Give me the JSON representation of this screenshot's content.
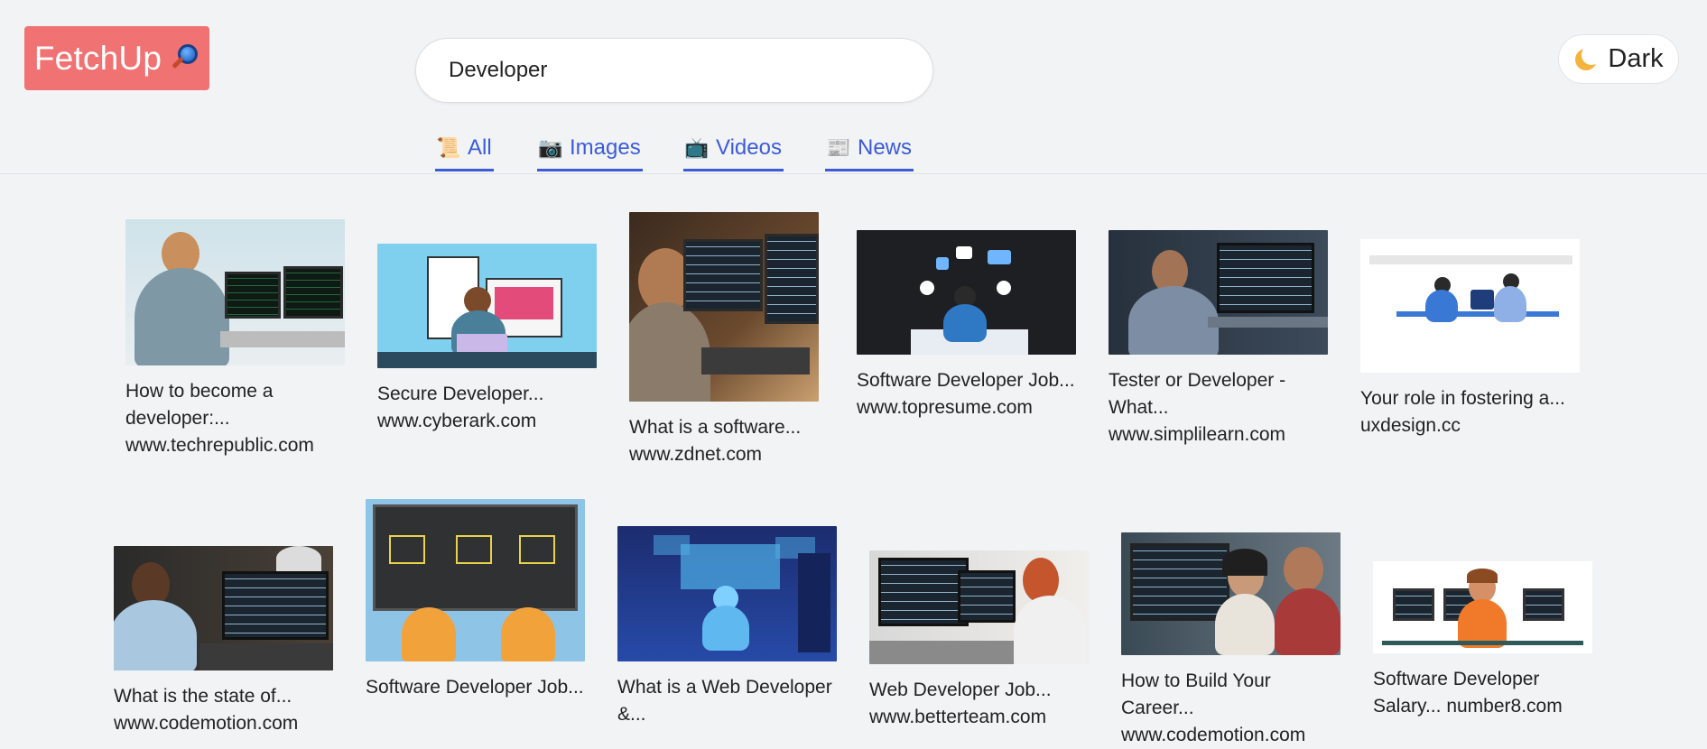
{
  "brand": {
    "name": "FetchUp",
    "icon": "magnifier-icon"
  },
  "search": {
    "value": "Developer"
  },
  "theme_toggle": {
    "label": "Dark",
    "icon": "moon-icon"
  },
  "tabs": [
    {
      "label": "All",
      "icon": "scroll-icon",
      "glyph": "📜"
    },
    {
      "label": "Images",
      "icon": "camera-icon",
      "glyph": "📷"
    },
    {
      "label": "Videos",
      "icon": "tv-icon",
      "glyph": "📺"
    },
    {
      "label": "News",
      "icon": "newspaper-icon",
      "glyph": "📰"
    }
  ],
  "results": [
    {
      "title": "How to become a developer:...",
      "source": "www.techrepublic.com"
    },
    {
      "title": "Secure Developer...",
      "source": "www.cyberark.com"
    },
    {
      "title": "What is a software...",
      "source": "www.zdnet.com"
    },
    {
      "title": "Software Developer Job...",
      "source": "www.topresume.com"
    },
    {
      "title": "Tester or Developer - What...",
      "source": "www.simplilearn.com"
    },
    {
      "title": "Your role in fostering a...",
      "source": "uxdesign.cc"
    },
    {
      "title": "What is the state of...",
      "source": "www.codemotion.com"
    },
    {
      "title": "Software Developer Job...",
      "source": ""
    },
    {
      "title": "What is a Web Developer &...",
      "source": ""
    },
    {
      "title": "Web Developer Job...",
      "source": "www.betterteam.com"
    },
    {
      "title": "How to Build Your Career...",
      "source": "www.codemotion.com"
    },
    {
      "title": "Software Developer Salary...",
      "source": "number8.com"
    }
  ],
  "colors": {
    "accent": "#3b5bdb",
    "brand": "#f07272",
    "background": "#f2f3f5"
  }
}
